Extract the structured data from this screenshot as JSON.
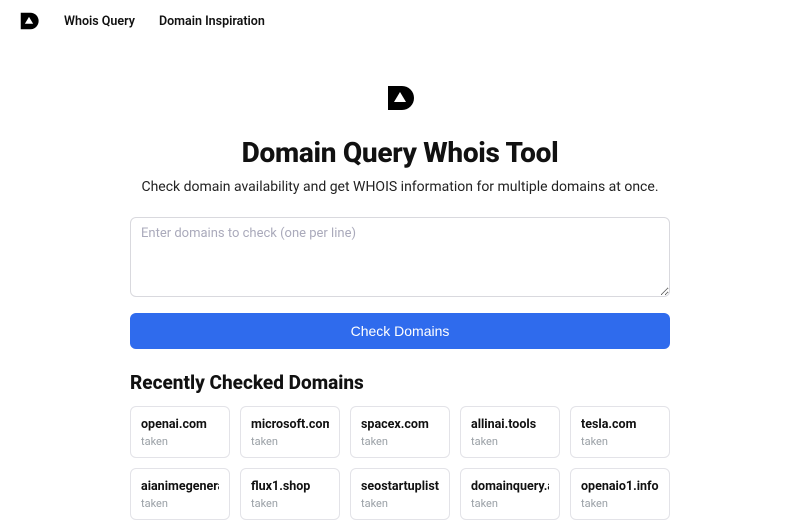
{
  "nav": {
    "links": [
      {
        "label": "Whois Query"
      },
      {
        "label": "Domain Inspiration"
      }
    ]
  },
  "hero": {
    "title": "Domain Query Whois Tool",
    "subtitle": "Check domain availability and get WHOIS information for multiple domains at once."
  },
  "form": {
    "placeholder": "Enter domains to check (one per line)",
    "value": "",
    "button_label": "Check Domains"
  },
  "recent": {
    "heading": "Recently Checked Domains",
    "items": [
      {
        "domain": "openai.com",
        "status": "taken"
      },
      {
        "domain": "microsoft.com",
        "status": "taken"
      },
      {
        "domain": "spacex.com",
        "status": "taken"
      },
      {
        "domain": "allinai.tools",
        "status": "taken"
      },
      {
        "domain": "tesla.com",
        "status": "taken"
      },
      {
        "domain": "aianimegenerator.art",
        "status": "taken"
      },
      {
        "domain": "flux1.shop",
        "status": "taken"
      },
      {
        "domain": "seostartuplist.com",
        "status": "taken"
      },
      {
        "domain": "domainquery.app",
        "status": "taken"
      },
      {
        "domain": "openaio1.info",
        "status": "taken"
      }
    ]
  },
  "icons": {
    "brand": "brand-logo-icon"
  },
  "colors": {
    "primary": "#2f6bed"
  }
}
